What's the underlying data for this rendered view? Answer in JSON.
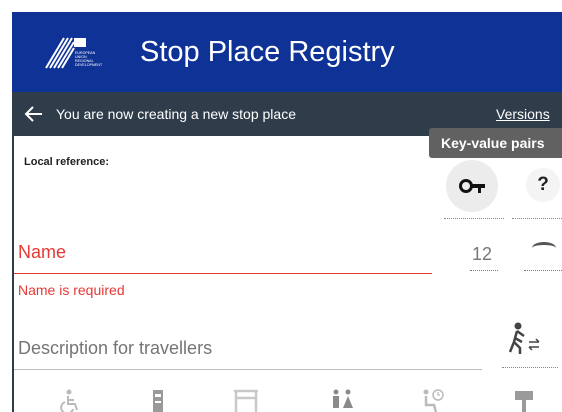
{
  "header": {
    "title": "Stop Place Registry",
    "logo_text": "EUROPEAN UNION REGIONAL DEVELOPMENT FUND",
    "brand_color": "#0f3296"
  },
  "subheader": {
    "message": "You are now creating a new stop place",
    "versions_label": "Versions",
    "background_color": "#2f3d4b"
  },
  "form": {
    "local_reference_label": "Local reference:",
    "name_label": "Name",
    "name_error": "Name is required",
    "name_side_value": "12",
    "description_label": "Description for travellers",
    "error_color": "#e53935"
  },
  "actions": {
    "key_icon": "key-icon",
    "help_label": "?",
    "tooltip_text": "Key-value pairs",
    "walk_icon": "walking-person-icon"
  },
  "facilities": [
    {
      "icon": "wheelchair-icon"
    },
    {
      "icon": "ticket-machine-icon"
    },
    {
      "icon": "shelter-icon"
    },
    {
      "icon": "toilet-icon"
    },
    {
      "icon": "waiting-room-icon"
    },
    {
      "icon": "sign-icon"
    }
  ]
}
